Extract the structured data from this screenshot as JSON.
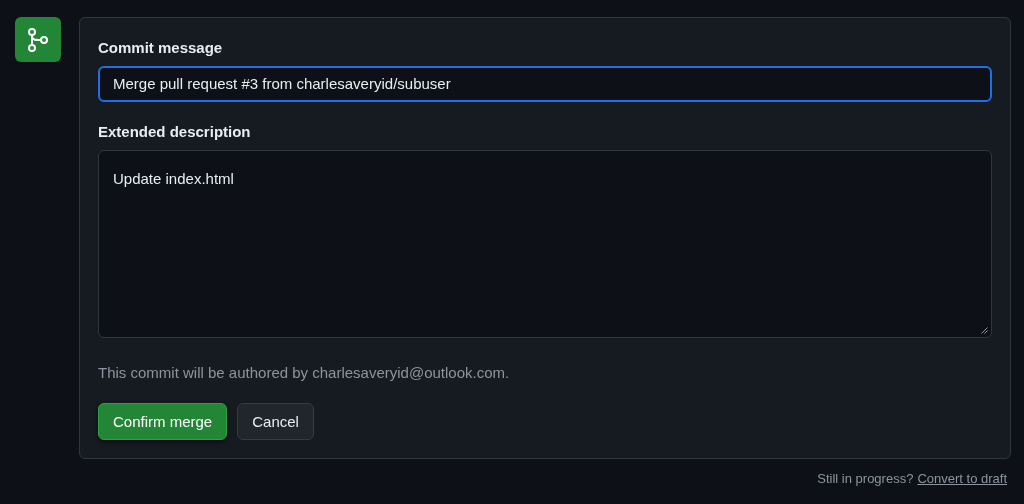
{
  "commit_form": {
    "commit_message_label": "Commit message",
    "commit_message": {
      "value": "Merge pull request #3 from charlesaveryid/subuser",
      "focused": true
    },
    "description_label": "Extended description",
    "description": {
      "value": "Update index.html",
      "focused": false
    },
    "author_note": "This commit will be authored by charlesaveryid@outlook.com.",
    "buttons": [
      {
        "label": "Confirm merge",
        "kind": "primary"
      },
      {
        "label": "Cancel",
        "kind": "secondary"
      }
    ]
  },
  "footer": {
    "text": "Still in progress?",
    "link": "Convert to draft"
  }
}
